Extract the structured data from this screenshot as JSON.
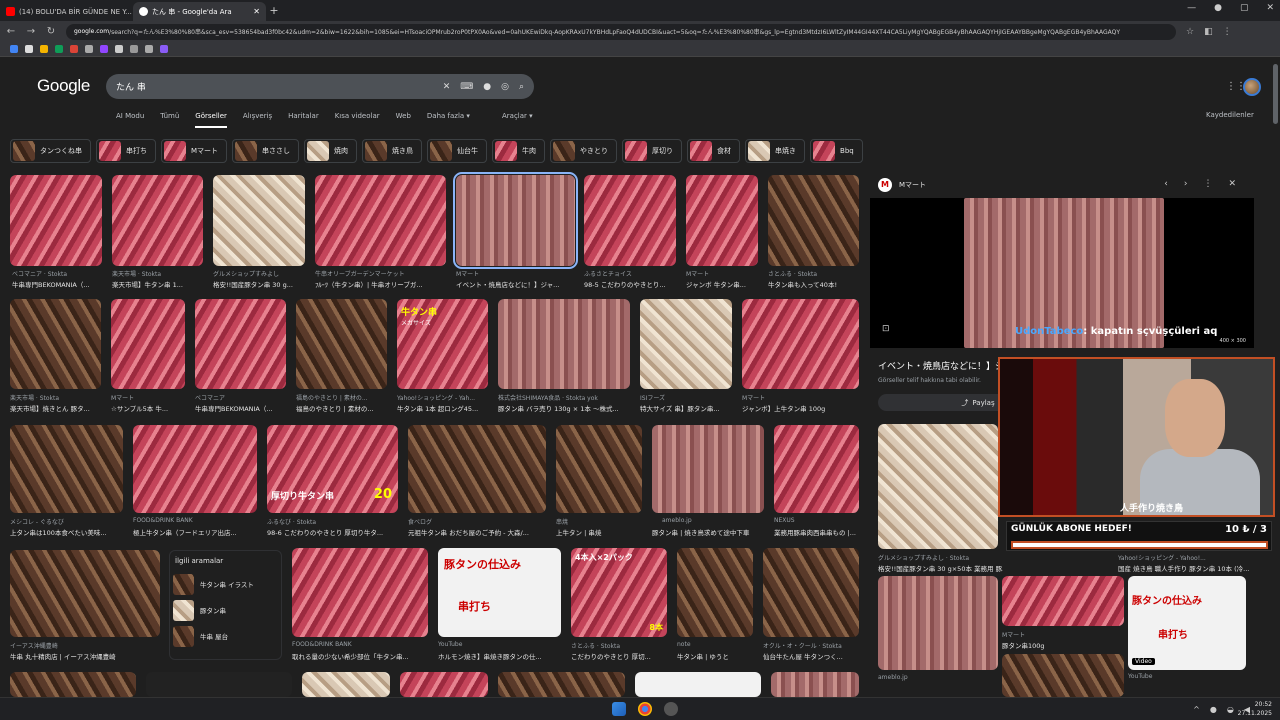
{
  "browser": {
    "tabs": [
      {
        "title": "(14) BOLU'DA BİR GÜNDE NE Y...",
        "active": false
      },
      {
        "title": "たん 串 - Google'da Ara",
        "active": true
      }
    ],
    "url_host": "google.com",
    "url_rest": "/search?q=たん%E3%80%80串&sca_esv=538654bad3f0bc42&udm=2&biw=1622&bih=1085&ei=HTsoaciOPMrub2roP0tPX0Ao&ved=0ahUKEwiDkq-AopKRAxU7kYBHdLpFaoQ4dUDCBI&uact=5&oq=たん%E3%80%80串&gs_lp=Egtnd3MtdzI6LWltZyIM44GI44XT44CA5LiyMgYQABgEGB4yBhAAGAQYHjIGEAAYBBgeMgYQABgEGB4yBhAAGAQY"
  },
  "google": {
    "logo": "Google",
    "query": "たん 串",
    "nav_tabs": [
      "AI Modu",
      "Tümü",
      "Görseller",
      "Alışveriş",
      "Haritalar",
      "Kısa videolar",
      "Web",
      "Daha fazla ▾"
    ],
    "selected_tab": "Görseller",
    "tools": "Araçlar ▾",
    "saved": "Kaydedilenler",
    "chips": [
      "タンつくね串",
      "串打ち",
      "Mマート",
      "串ささし",
      "焼肉",
      "焼き鳥",
      "仙台牛",
      "牛肉",
      "やきとり",
      "厚切り",
      "食材",
      "串焼き",
      "Bbq"
    ]
  },
  "grid": {
    "row1": [
      {
        "source": "ベコマニア · Stokta",
        "caption": "牛串専門BEKOMANIA（..."
      },
      {
        "source": "楽天市場 · Stokta",
        "caption": "楽天市場】牛タン串 1..."
      },
      {
        "source": "グルメショップすみよし",
        "caption": "格安!!国産豚タン串 30 g..."
      },
      {
        "source": "牛串オリーブガーデンマーケット",
        "caption": "ﾌﾙｰﾂ（牛タン串）| 牛串オリーブガ..."
      },
      {
        "source": "Mマート",
        "caption": "イベント・焼鳥店などに！】ジャ..."
      },
      {
        "source": "ふるさとチョイス",
        "caption": "98-5 こだわりのやきとり..."
      },
      {
        "source": "Mマート",
        "caption": "ジャンボ 牛タン串..."
      },
      {
        "source": "さとふる · Stokta",
        "caption": "牛タン串も入って40本!"
      }
    ],
    "row2": [
      {
        "source": "楽天市場 · Stokta",
        "caption": "楽天市場】焼きとん 豚タ..."
      },
      {
        "source": "Mマート",
        "caption": "☆サンプル5本 牛..."
      },
      {
        "source": "ベコマニア",
        "caption": "牛串専門BEKOMANIA（..."
      },
      {
        "source": "福島のやきとり | 素材の...",
        "caption": "福島のやきとり | 素材の..."
      },
      {
        "source": "Yahoo!ショッピング - Yah...",
        "caption": "牛タン串 1本 超ロング45..."
      },
      {
        "source": "株式会社SHIMAYA食品 · Stokta yok",
        "caption": "豚タン串 バラ売り 130g × 1本 ～株式..."
      },
      {
        "source": "ISIフーズ",
        "caption": "特大サイズ 串】豚タン串..."
      },
      {
        "source": "Mマート",
        "caption": "ジャンボ】上牛タン串 100g"
      }
    ],
    "row3": [
      {
        "source": "メシコレ - ぐるなび",
        "caption": "上タン串は100本食べたい美味..."
      },
      {
        "source": "FOOD&DRINK BANK",
        "caption": "極上牛タン串（フードエリア出店..."
      },
      {
        "source": "ふるなび · Stokta",
        "caption": "98-6 こだわりのやきとり 厚切り牛タ..."
      },
      {
        "source": "食べログ",
        "caption": "元祖牛タン串 おだち屋のご予約 - 大森/..."
      },
      {
        "source": "串焼",
        "caption": "上牛タン | 串焼"
      },
      {
        "source": "ameblo.jp",
        "caption": "豚タン串 | 焼き鳥求めて途中下車"
      },
      {
        "source": "NEXUS",
        "caption": "業務用豚串肉西串串もの |..."
      }
    ],
    "row4": [
      {
        "source": "イーアス沖縄豊崎",
        "caption": "牛串 丸十精肉店 | イーアス沖縄豊崎"
      },
      {
        "source": "FOOD&DRINK BANK",
        "caption": "取れる量の少ない希少部位「牛タン串..."
      },
      {
        "source": "YouTube",
        "caption": "ホルモン焼き】串焼き豚タンの仕..."
      },
      {
        "source": "さとふる · Stokta",
        "caption": "こだわりのやきとり 厚切..."
      },
      {
        "source": "note",
        "caption": "牛タン串 | ゆうと"
      },
      {
        "source": "オクル・オ・クール · Stokta",
        "caption": "仙台牛たん屋 牛タンつく..."
      }
    ],
    "overlay_texts": [
      "牛タン串",
      "メガサイズ",
      "厚切り牛タン串",
      "20",
      "豚タンの仕込み",
      "串打ち",
      "4本入×2パック",
      "8本"
    ]
  },
  "related": {
    "heading": "İlgili aramalar",
    "items": [
      "牛タン串 イラスト",
      "豚タン串",
      "牛串 屋台"
    ]
  },
  "panel": {
    "source": "Mマート",
    "title": "イベント・焼鳥店などに！】ジ...",
    "subtitle": "Görseller telif hakkına tabi olabilir.",
    "share": "Paylaş",
    "image_size": "400 × 300",
    "thumbs": [
      {
        "source": "グルメショップすみよし · Stokta",
        "caption": "格安!!国産豚タン串 30 g×50本 業務用 豚..."
      },
      {
        "source": "Yahoo!ショッピング - Yahoo!...",
        "caption": "国産 焼き鳥 職人手作り 豚タン串 10本 (冷..."
      },
      {
        "source": "Mマート",
        "caption": "豚タン串100g"
      },
      {
        "source": "ameblo.jp",
        "caption": ""
      },
      {
        "source": "YouTube",
        "caption": ""
      }
    ],
    "video_badge": "Video"
  },
  "stream": {
    "chat_user": "UdonTabeco",
    "chat_msg": ": kapatın sçvüşçüleri aq",
    "goal_label": "GÜNLÜK ABONE HEDEF!",
    "goal_count": "10 ₺ / 3",
    "goal_progress": 0.95,
    "banner": "人手作り焼き鳥"
  },
  "taskbar": {
    "time": "20:52",
    "date": "27.11.2025"
  },
  "colors": {
    "accent": "#8ab4f8",
    "stream_border": "#c24f24",
    "bg": "#1f1f1f"
  }
}
